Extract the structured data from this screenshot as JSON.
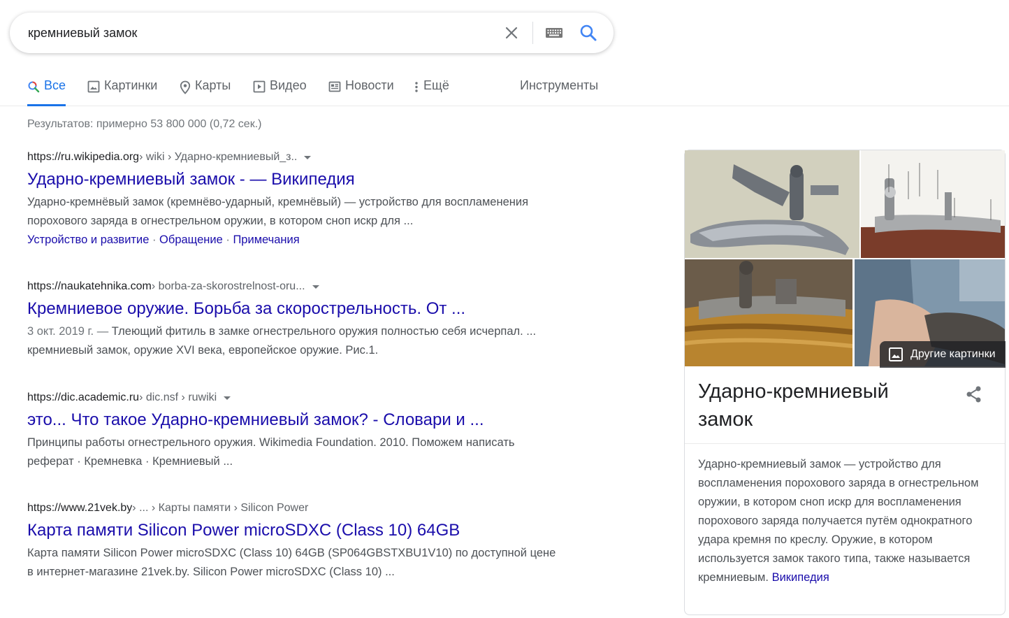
{
  "search": {
    "query": "кремниевый замок"
  },
  "tabs": [
    {
      "label": "Все",
      "icon": "search-icon",
      "active": true
    },
    {
      "label": "Картинки",
      "icon": "image-icon"
    },
    {
      "label": "Карты",
      "icon": "map-pin-icon"
    },
    {
      "label": "Видео",
      "icon": "video-icon"
    },
    {
      "label": "Новости",
      "icon": "news-icon"
    },
    {
      "label": "Ещё",
      "icon": "more-vert-icon"
    }
  ],
  "tools_label": "Инструменты",
  "stats": "Результатов: примерно 53 800 000 (0,72 сек.)",
  "results": [
    {
      "domain": "https://ru.wikipedia.org",
      "path": " › wiki › Ударно-кремниевый_з..",
      "title": "Ударно-кремниевый замок - — Википедия",
      "snippet": "Ударно-кремнёвый замок (кремнёво-ударный, кремнёвый) — устройство для воспламенения порохового заряда в огнестрельном оружии, в котором сноп искр для ...",
      "sitelinks": [
        "Устройство и развитие",
        "Обращение",
        "Примечания"
      ]
    },
    {
      "domain": "https://naukatehnika.com",
      "path": " › borba-za-skorostrelnost-oru...",
      "title": "Кремниевое оружие. Борьба за скорострельность. От ...",
      "date": "3 окт. 2019 г. — ",
      "snippet": "Тлеющий фитиль в замке огнестрельного оружия полностью себя исчерпал. ... кремниевый замок, оружие XVI века, европейское оружие. Рис.1."
    },
    {
      "domain": "https://dic.academic.ru",
      "path": " › dic.nsf › ruwiki",
      "title": "это... Что такое Ударно-кремниевый замок? - Словари и ...",
      "snippet": "Принципы работы огнестрельного оружия. Wikimedia Foundation. 2010. Поможем написать реферат · Кремневка · Кремниевый ..."
    },
    {
      "domain": "https://www.21vek.by",
      "path": " › ... › Карты памяти › Silicon Power",
      "title": "Карта памяти Silicon Power microSDXC (Class 10) 64GB",
      "snippet": "Карта памяти Silicon Power microSDXC (Class 10) 64GB (SP064GBSTXBU1V10) по доступной цене в интернет-магазине 21vek.by. Silicon Power microSDXC (Class 10) ..."
    }
  ],
  "knowledge_panel": {
    "more_images_label": "Другие картинки",
    "title": "Ударно-кремниевый замок",
    "description": "Ударно-кремниевый замок — устройство для воспламенения порохового заряда в огнестрельном оружии, в котором сноп искр для воспламенения порохового заряда получается путём однократного удара кремня по креслу. Оружие, в котором используется замок такого типа, также называется кремниевым. ",
    "source_link": "Википедия"
  },
  "colors": {
    "link": "#1a0dab",
    "accent": "#1a73e8",
    "snippet": "#4d5156",
    "muted": "#70757a"
  }
}
